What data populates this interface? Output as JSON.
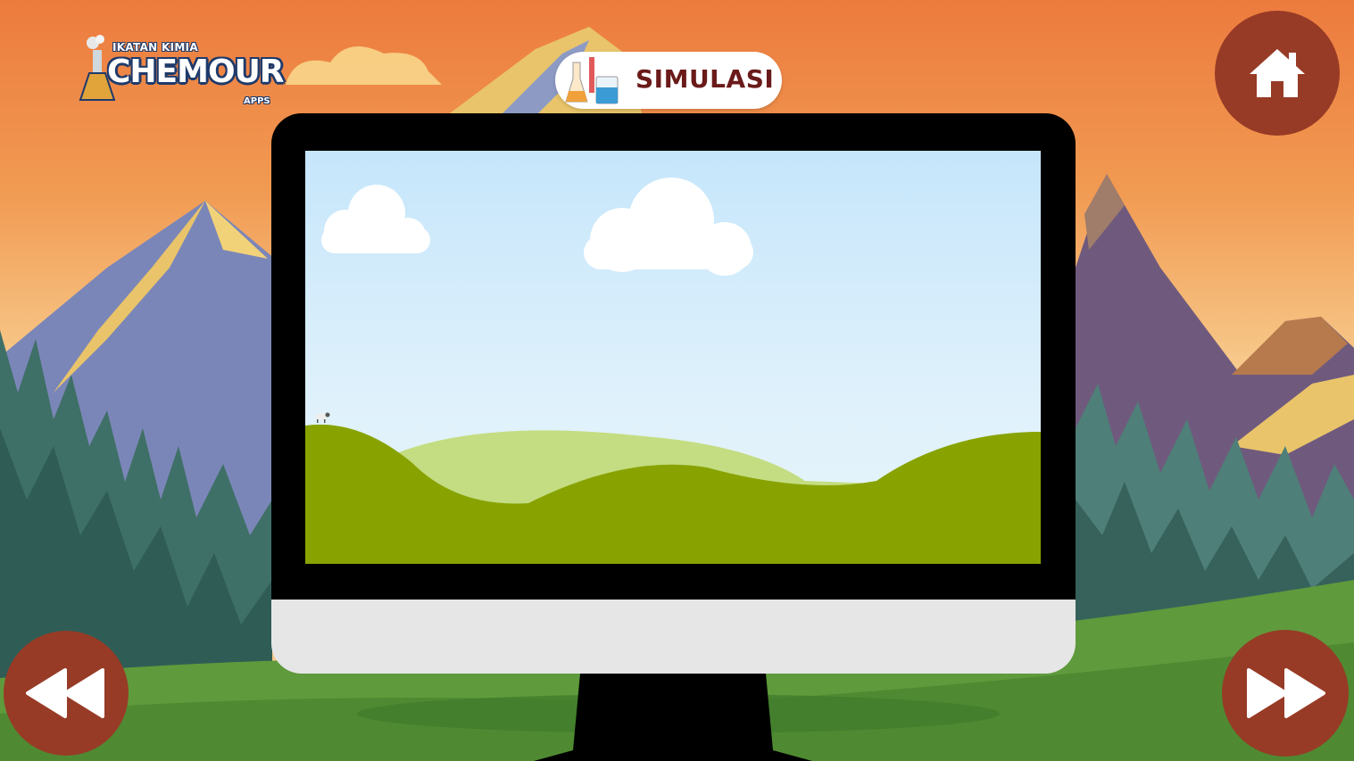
{
  "logo": {
    "top_text": "IKATAN KIMIA",
    "main_text": "CHEMOUR",
    "sub_text": "APPS"
  },
  "header": {
    "title": "SIMULASI",
    "title_icon": "lab-glassware-icon"
  },
  "nav": {
    "home_icon": "home-icon",
    "prev_icon": "rewind-icon",
    "next_icon": "fast-forward-icon"
  },
  "colors": {
    "button_bg": "#973b26",
    "title_text": "#6b1a1a",
    "sky_top": "#ec7b3e",
    "grass": "#88a300"
  }
}
